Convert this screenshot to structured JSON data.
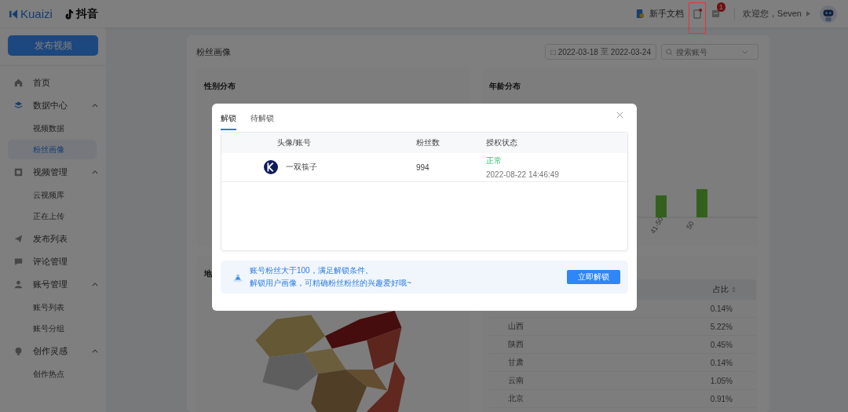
{
  "header": {
    "brand": "Kuaizi",
    "platform": "抖音",
    "doc_link": "新手文档",
    "message_badge": "1",
    "greeting": "欢迎您，Seven"
  },
  "sidebar": {
    "publish_button": "发布视频",
    "items": [
      {
        "label": "首页",
        "selected": false
      },
      {
        "label": "数据中心",
        "selected": false,
        "expanded": true,
        "children": [
          {
            "label": "视频数据",
            "selected": false
          },
          {
            "label": "粉丝画像",
            "selected": true
          }
        ]
      },
      {
        "label": "视频管理",
        "selected": false,
        "expanded": true,
        "children": [
          {
            "label": "云视频库",
            "selected": false
          },
          {
            "label": "正在上传",
            "selected": false
          }
        ]
      },
      {
        "label": "发布列表",
        "selected": false
      },
      {
        "label": "评论管理",
        "selected": false
      },
      {
        "label": "账号管理",
        "selected": false,
        "expanded": true,
        "children": [
          {
            "label": "账号列表",
            "selected": false
          },
          {
            "label": "账号分组",
            "selected": false
          }
        ]
      },
      {
        "label": "创作灵感",
        "selected": false,
        "expanded": true,
        "children": [
          {
            "label": "创作热点",
            "selected": false
          }
        ]
      }
    ]
  },
  "page": {
    "title": "粉丝画像",
    "date_start": "2022-03-18",
    "date_sep": "至",
    "date_end": "2022-03-24",
    "search": {
      "placeholder": "搜索账号"
    },
    "gender_card": {
      "title": "性别分布"
    },
    "age_card": {
      "title": "年龄分布",
      "bar_labels": [
        "41-50",
        "50"
      ]
    },
    "map_card": {
      "title": "地"
    },
    "region_table": {
      "share_column": "占比",
      "rows": [
        {
          "share": "0.14%"
        },
        {
          "region": "山西",
          "share": "5.22%"
        },
        {
          "region": "陕西",
          "share": "0.45%"
        },
        {
          "region": "甘肃",
          "share": "0.14%"
        },
        {
          "region": "云南",
          "share": "1.05%"
        },
        {
          "region": "北京",
          "share": "0.91%"
        }
      ]
    }
  },
  "dialog": {
    "tabs": [
      {
        "label": "解锁",
        "selected": true
      },
      {
        "label": "待解锁",
        "selected": false
      }
    ],
    "columns": [
      "头像/账号",
      "粉丝数",
      "授权状态"
    ],
    "rows": [
      {
        "account": "一双筷子",
        "fans": "994",
        "status": {
          "text": "正常",
          "kind": "ok"
        },
        "status_time": "2022-08-22 14:46:49"
      }
    ],
    "notice": [
      "账号粉丝大于100，满足解锁条件。",
      "解锁用户画像，可精确粉丝粉丝的兴趣爱好哦~"
    ],
    "unlock_button": "立即解锁"
  }
}
